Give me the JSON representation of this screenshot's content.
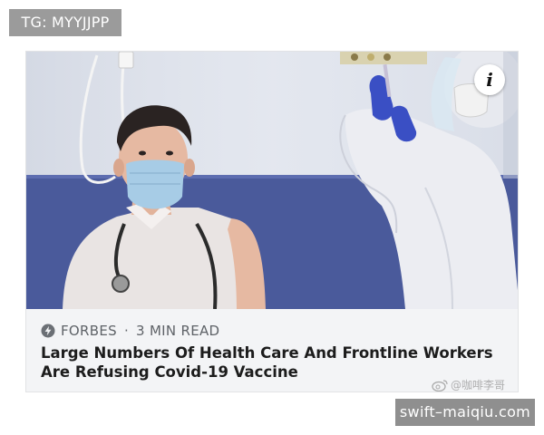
{
  "top_label": "TG: MYYJJPP",
  "card": {
    "info_button": "i",
    "source": "FORBES",
    "separator": "·",
    "read_time": "3 MIN READ",
    "headline": "Large Numbers Of Health Care And Frontline Workers Are Refusing Covid-19 Vaccine"
  },
  "watermark": "@咖啡李哥",
  "site_label": "swift–maiqiu.com",
  "colors": {
    "wall_upper": "#dde2ec",
    "wall_lower": "#4a5a9b",
    "mask": "#a7cce6",
    "glove": "#3a4fc4",
    "info_bg": "#ffffff",
    "card_bg": "#f3f4f6"
  }
}
